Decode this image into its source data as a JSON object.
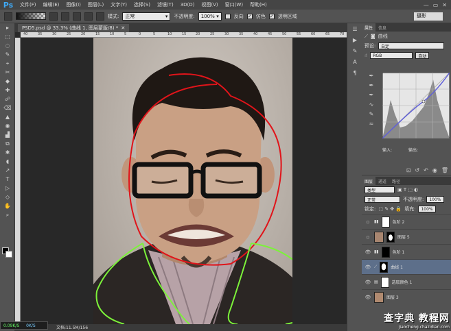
{
  "app": {
    "logo": "Ps",
    "menus": [
      "文件(F)",
      "编辑(E)",
      "图像(I)",
      "图层(L)",
      "文字(Y)",
      "选择(S)",
      "滤镜(T)",
      "3D(D)",
      "视图(V)",
      "窗口(W)",
      "帮助(H)"
    ],
    "window_controls": [
      "—",
      "▭",
      "✕"
    ]
  },
  "options_bar": {
    "mode_label": "模式:",
    "mode_value": "正常",
    "opacity_label": "不透明度:",
    "opacity_value": "100%",
    "reverse_label": "反向",
    "reverse_checked": false,
    "dither_label": "仿色",
    "dither_checked": true,
    "transparency_label": "透明区域",
    "transparency_checked": true,
    "workspace": "摄影"
  },
  "document": {
    "tab_title": "PSD5.psd @ 33.3% (曲线 1, 图层蒙版/8) *",
    "tab_close": "✕",
    "ruler_ticks": [
      "40",
      "35",
      "30",
      "25",
      "20",
      "15",
      "10",
      "5",
      "0",
      "5",
      "10",
      "15",
      "20",
      "25",
      "30",
      "35",
      "40",
      "45",
      "50",
      "55",
      "60",
      "65",
      "70"
    ],
    "status": "文档:11.5M/156"
  },
  "tools": [
    "▸",
    "⬚",
    "◌",
    "✎",
    "⌖",
    "✂",
    "◆",
    "✚",
    "☍",
    "⌫",
    "▲",
    "◉",
    "▟",
    "⧉",
    "✱",
    "◖",
    "↗",
    "T",
    "▷",
    "◇",
    "✋",
    "⌕"
  ],
  "net_meter": {
    "up": "0.09K/S",
    "down": "0K/S"
  },
  "properties_panel": {
    "tabs": [
      "属性",
      "信息"
    ],
    "type_label": "曲线",
    "preset_label": "预设:",
    "preset_value": "自定",
    "channel_value": "RGB",
    "auto_button": "自动",
    "input_label": "输入:",
    "output_label": "输出:",
    "footer_icons": [
      "⊡",
      "↺",
      "↶",
      "◉",
      "🗑"
    ]
  },
  "layers_panel": {
    "tabs": [
      "图层",
      "通道",
      "路径"
    ],
    "filter_label": "类型",
    "blend_mode": "正常",
    "opacity_label": "不透明度:",
    "opacity_value": "100%",
    "lock_label": "锁定:",
    "fill_label": "填充:",
    "fill_value": "100%",
    "layers": [
      {
        "name": "色阶 2",
        "visible": false,
        "selected": false
      },
      {
        "name": "图层 5",
        "visible": false,
        "selected": false
      },
      {
        "name": "色阶 1",
        "visible": true,
        "selected": false
      },
      {
        "name": "曲线 1",
        "visible": true,
        "selected": true
      },
      {
        "name": "选取颜色 1",
        "visible": true,
        "selected": false
      },
      {
        "name": "图层 3",
        "visible": true,
        "selected": false
      }
    ]
  },
  "watermark": {
    "main": "查字典 教程网",
    "sub": "jiaocheng.chazidian.com"
  },
  "colors": {
    "annotation_red": "#e0141a",
    "annotation_green": "#7cf23a",
    "selection_blue": "#5d6f8a"
  }
}
